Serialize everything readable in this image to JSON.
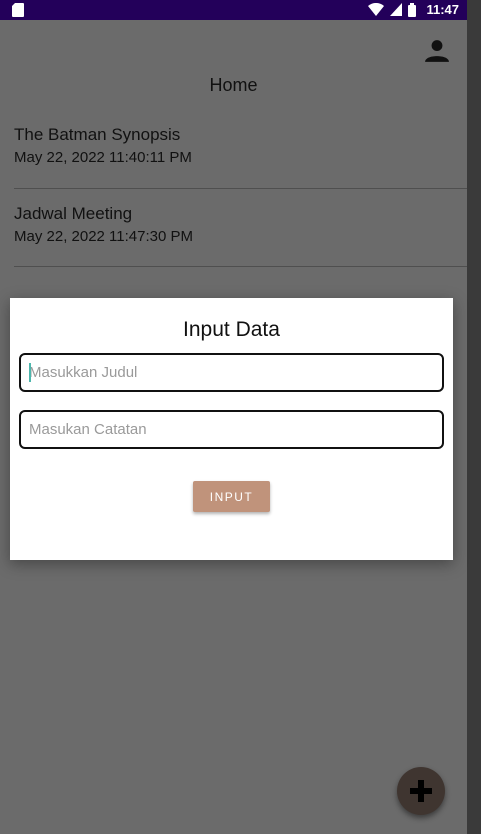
{
  "status_bar": {
    "time": "11:47",
    "icons": [
      "sd-card-icon",
      "wifi-icon",
      "signal-icon",
      "battery-icon"
    ]
  },
  "header": {
    "title": "Home",
    "profile_icon": "person-icon"
  },
  "notes": [
    {
      "title": "The Batman Synopsis",
      "date": "May 22, 2022 11:40:11 PM"
    },
    {
      "title": "Jadwal Meeting",
      "date": "May 22, 2022 11:47:30 PM"
    }
  ],
  "dialog": {
    "title": "Input Data",
    "title_field": {
      "placeholder": "Masukkan Judul",
      "value": ""
    },
    "note_field": {
      "placeholder": "Masukan Catatan",
      "value": ""
    },
    "button_label": "INPUT"
  },
  "fab": {
    "icon": "plus-icon"
  },
  "colors": {
    "status_bar": "#23005a",
    "button": "#c0937b",
    "fab": "#3f3530",
    "caret": "#4db6ac"
  }
}
